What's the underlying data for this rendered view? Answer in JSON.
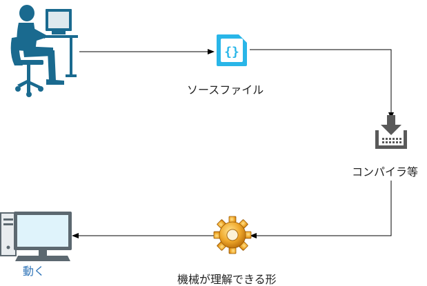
{
  "labels": {
    "source_file": "ソースファイル",
    "compiler": "コンパイラ等",
    "machine_code": "機械が理解できる形",
    "runs": "動く"
  },
  "icons": {
    "programmer": "person-at-computer-icon",
    "source_file": "source-file-icon",
    "compiler": "compiler-download-icon",
    "machine_code": "gear-icon",
    "computer": "desktop-computer-icon"
  },
  "colors": {
    "programmer": "#1a6a8f",
    "file_icon": "#29b6e8",
    "compiler_icon": "#595959",
    "gear": "#f0a92c",
    "computer_icon": "#5c6870",
    "computer_screen": "#dff3fb",
    "run_label": "#2f74b8",
    "connector": "#000000"
  }
}
